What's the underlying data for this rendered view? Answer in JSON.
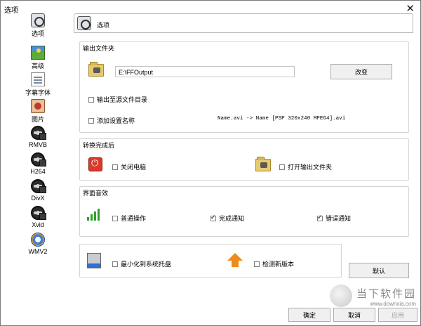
{
  "window": {
    "title": "选项",
    "close_glyph": "✕"
  },
  "sidebar": {
    "items": [
      {
        "label": "选项",
        "icon": "options-icon"
      },
      {
        "label": "高级",
        "icon": "landscape-icon"
      },
      {
        "label": "字幕字体",
        "icon": "document-icon"
      },
      {
        "label": "图片",
        "icon": "picture-icon"
      },
      {
        "label": "RMVB",
        "icon": "film-reel-icon"
      },
      {
        "label": "H264",
        "icon": "film-reel-icon"
      },
      {
        "label": "DivX",
        "icon": "film-reel-icon"
      },
      {
        "label": "Xvid",
        "icon": "film-reel-icon"
      },
      {
        "label": "WMV2",
        "icon": "windows-media-icon"
      }
    ]
  },
  "header": {
    "title": "选项"
  },
  "output_folder": {
    "group_title": "输出文件夹",
    "path_value": "E:\\FFOutput",
    "change_button": "改变",
    "output_to_source_label": "输出至源文件目录",
    "output_to_source_checked": false,
    "add_setting_name_label": "添加设置名称",
    "add_setting_name_checked": false,
    "name_example": "Name.avi  -> Name [PSP 320x240 MPEG4].avi"
  },
  "after_conversion": {
    "group_title": "转换完成后",
    "shutdown_label": "关闭电脑",
    "shutdown_checked": false,
    "open_output_label": "打开输出文件夹",
    "open_output_checked": false
  },
  "ui_sound": {
    "group_title": "界面音效",
    "normal_label": "普通操作",
    "normal_checked": false,
    "complete_label": "完成通知",
    "complete_checked": true,
    "error_label": "错误通知",
    "error_checked": true
  },
  "misc": {
    "minimize_tray_label": "最小化到系统托盘",
    "minimize_tray_checked": false,
    "check_update_label": "检测新版本",
    "check_update_checked": false
  },
  "buttons": {
    "default": "默认",
    "ok": "确定",
    "cancel": "取消",
    "apply": "应用"
  },
  "watermark": {
    "line1": "当下软件园",
    "line2": "www.downxia.com"
  }
}
